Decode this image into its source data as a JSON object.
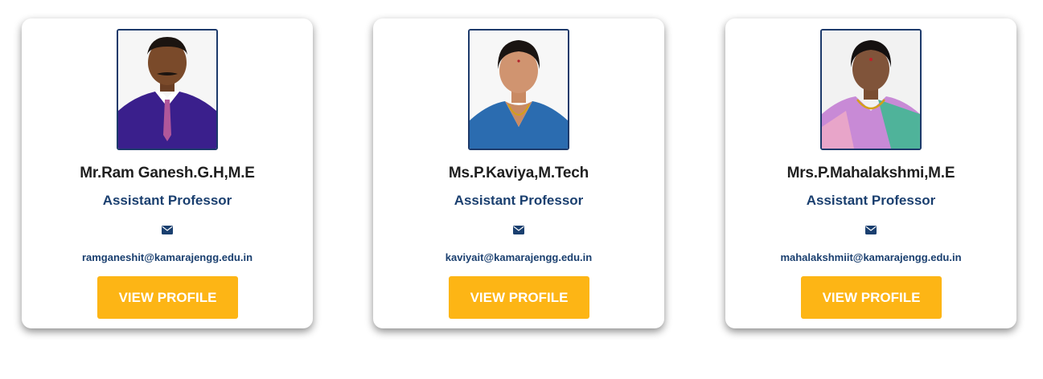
{
  "faculty": [
    {
      "name": "Mr.Ram Ganesh.G.H,M.E",
      "designation": "Assistant Professor",
      "email": "ramganeshit@kamarajengg.edu.in",
      "button_label": "VIEW PROFILE",
      "icon": "envelope-icon"
    },
    {
      "name": "Ms.P.Kaviya,M.Tech",
      "designation": "Assistant Professor",
      "email": "kaviyait@kamarajengg.edu.in",
      "button_label": "VIEW PROFILE",
      "icon": "envelope-icon"
    },
    {
      "name": "Mrs.P.Mahalakshmi,M.E",
      "designation": "Assistant Professor",
      "email": "mahalakshmiit@kamarajengg.edu.in",
      "button_label": "VIEW PROFILE",
      "icon": "envelope-icon"
    }
  ],
  "colors": {
    "button": "#fdb515",
    "designation_text": "#1a3f6f",
    "photo_border": "#1d3a6b"
  }
}
